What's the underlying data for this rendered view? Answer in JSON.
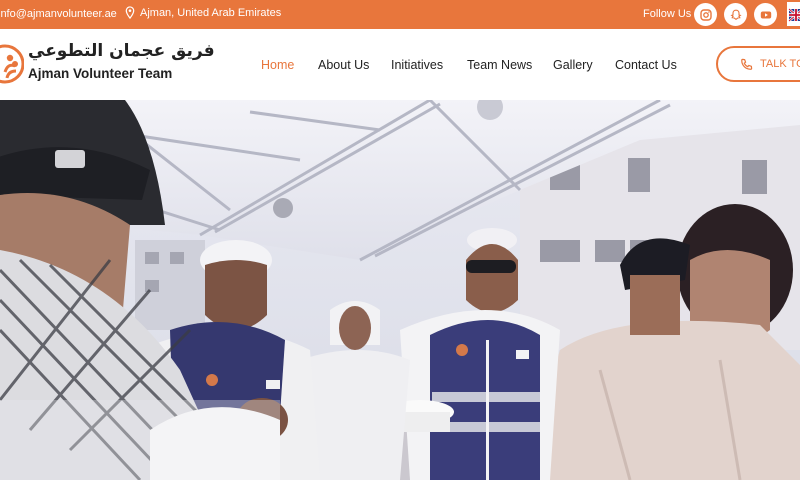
{
  "topbar": {
    "email": "info@ajmanvolunteer.ae",
    "location": "Ajman, United Arab Emirates",
    "follow_label": "Follow Us",
    "social": [
      "instagram-icon",
      "snapchat-icon",
      "youtube-icon"
    ],
    "bg_color": "#e8763c"
  },
  "header": {
    "logo_arabic": "فريق عجمان التطوعي",
    "logo_english": "Ajman Volunteer Team",
    "nav": [
      {
        "label": "Home",
        "active": true
      },
      {
        "label": "About Us",
        "active": false
      },
      {
        "label": "Initiatives",
        "active": false
      },
      {
        "label": "Team News",
        "active": false
      },
      {
        "label": "Gallery",
        "active": false
      },
      {
        "label": "Contact Us",
        "active": false
      }
    ],
    "cta_label": "TALK TO",
    "accent_color": "#e8763c"
  }
}
